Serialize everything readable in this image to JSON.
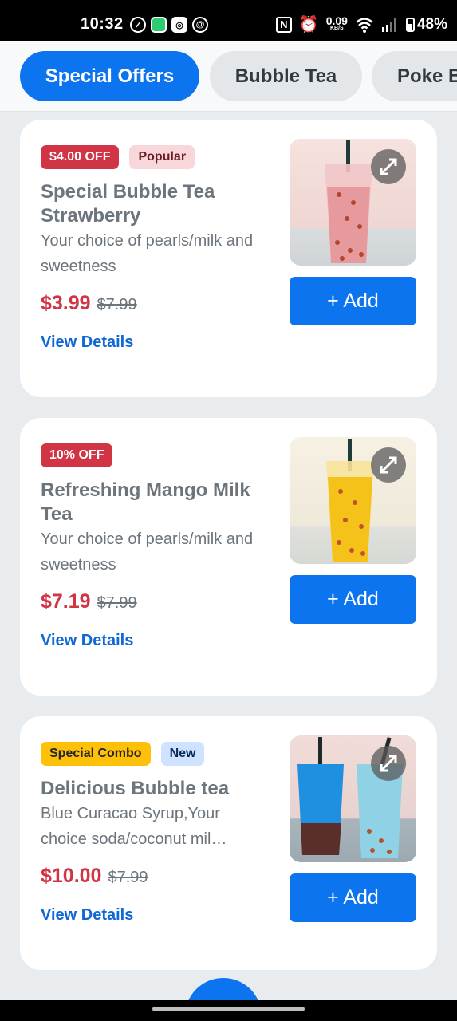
{
  "status_bar": {
    "time": "10:32",
    "net_speed_value": "0.09",
    "net_speed_unit": "KB/S",
    "battery": "48%",
    "left_icons": [
      "check-circle-icon",
      "message-app-icon",
      "camera-app-icon",
      "threads-icon"
    ],
    "right_icons": [
      "nfc-icon",
      "alarm-icon",
      "wifi-icon",
      "signal-icon",
      "battery-icon"
    ]
  },
  "tabs": [
    {
      "label": "Special Offers",
      "active": true
    },
    {
      "label": "Bubble Tea",
      "active": false
    },
    {
      "label": "Poke Bowl",
      "active": false
    }
  ],
  "products": [
    {
      "badges": [
        {
          "text": "$4.00 OFF",
          "style": "red"
        },
        {
          "text": "Popular",
          "style": "pink"
        }
      ],
      "title": "Special Bubble Tea Strawberry",
      "description": "Your choice of pearls/milk and sweetness",
      "price": "$3.99",
      "old_price": "$7.99",
      "details_label": "View Details",
      "add_label": "+ Add",
      "drink_color": "#e79a9e"
    },
    {
      "badges": [
        {
          "text": "10% OFF",
          "style": "red"
        }
      ],
      "title": "Refreshing Mango Milk Tea",
      "description": "Your choice of pearls/milk and sweetness",
      "price": "$7.19",
      "old_price": "$7.99",
      "details_label": "View Details",
      "add_label": "+ Add",
      "drink_color": "#f5c21a"
    },
    {
      "badges": [
        {
          "text": "Special Combo",
          "style": "yellow"
        },
        {
          "text": "New",
          "style": "blue"
        }
      ],
      "title": "Delicious Bubble tea",
      "description": "Blue Curacao Syrup,Your choice soda/coconut mil…",
      "price": "$10.00",
      "old_price": "$7.99",
      "details_label": "View Details",
      "add_label": "+ Add",
      "drink_color": "#1f8fe0"
    }
  ],
  "colors": {
    "accent": "#0b74ee",
    "price_red": "#d13444",
    "link_blue": "#1068d6"
  }
}
